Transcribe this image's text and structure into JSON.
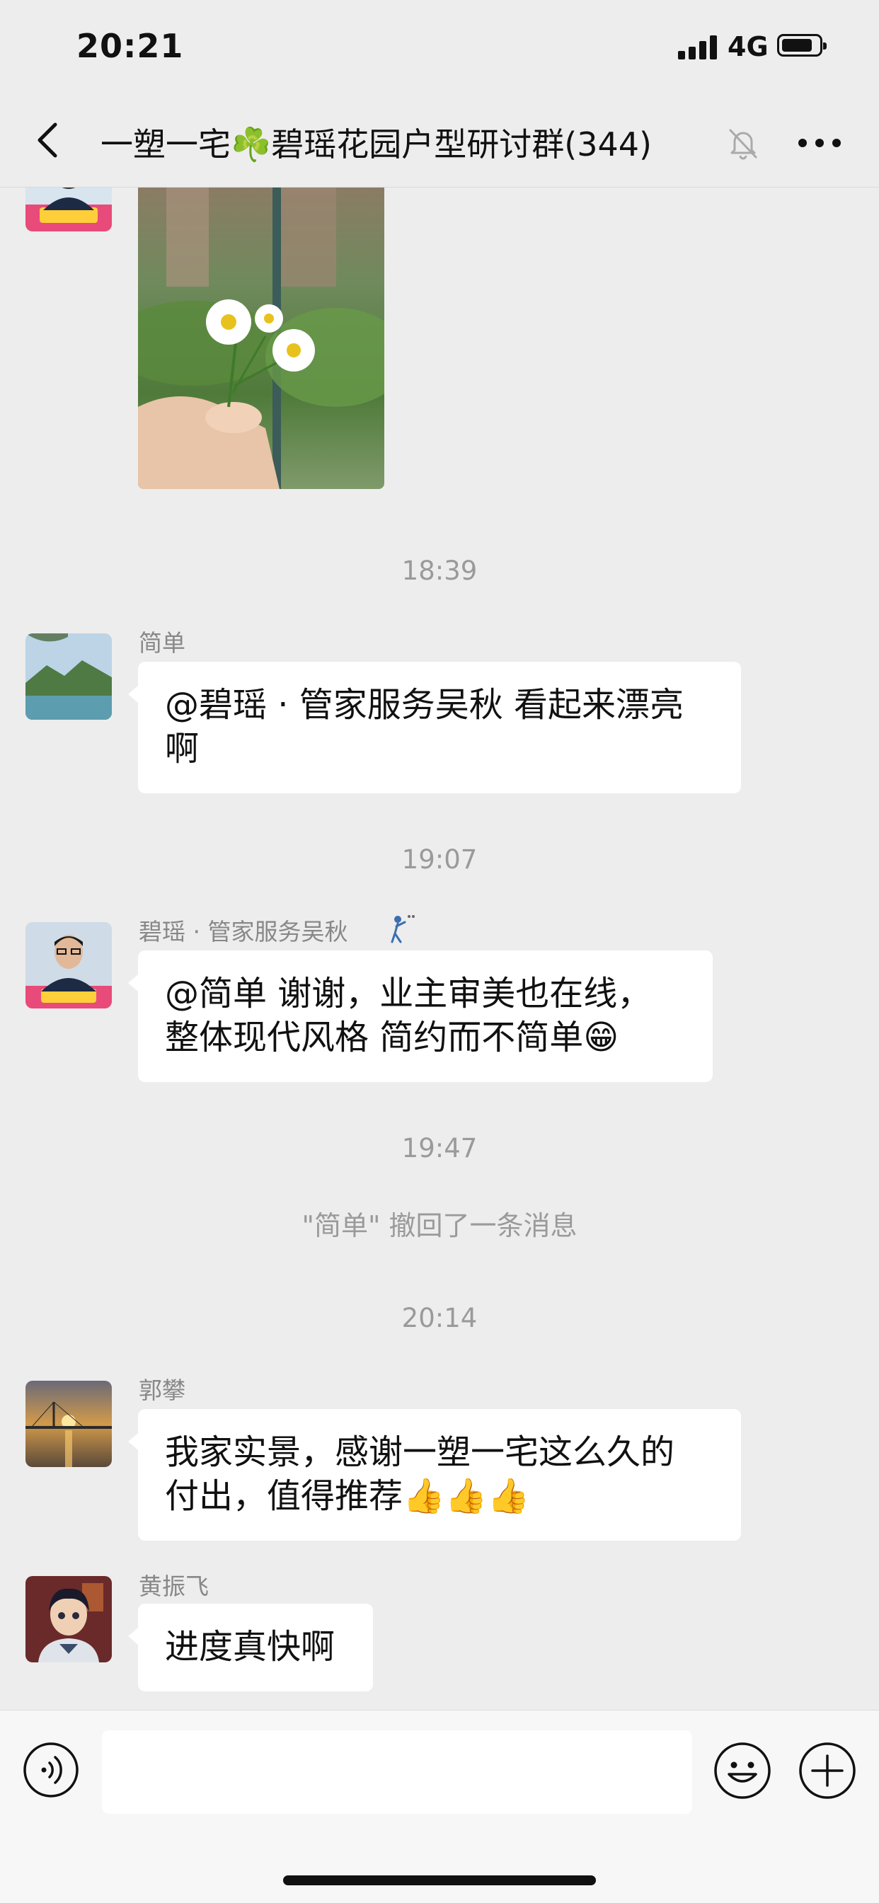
{
  "status_bar": {
    "time": "20:21",
    "network": "4G"
  },
  "header": {
    "title": "一塑一宅☘️碧瑶花园户型研讨群(344)",
    "back_icon": "chevron-left-icon",
    "mute_icon": "bell-slash-icon",
    "more_icon": "more-dots-icon"
  },
  "messages": [
    {
      "type": "image",
      "sender_avatar": "avatar-wu-qiu",
      "image": "photo-daisy-flowers-in-hand"
    },
    {
      "type": "timestamp",
      "text": "18:39"
    },
    {
      "type": "text",
      "sender": "简单",
      "text_line1": "@碧瑶 · 管家服务吴秋 看起来漂亮",
      "text_line2": "啊"
    },
    {
      "type": "timestamp",
      "text": "19:07"
    },
    {
      "type": "text",
      "sender": "碧瑶 · 管家服务吴秋",
      "sender_badge": "person-status-icon",
      "text_line1": "@简单   谢谢，业主审美也在线，",
      "text_line2": "整体现代风格  简约而不简单😁"
    },
    {
      "type": "timestamp",
      "text": "19:47"
    },
    {
      "type": "system",
      "text": "\"简单\" 撤回了一条消息"
    },
    {
      "type": "timestamp",
      "text": "20:14"
    },
    {
      "type": "text",
      "sender": "郭攀",
      "text_line1": "我家实景，感谢一塑一宅这么久的",
      "text_line2": "付出，值得推荐👍👍👍"
    },
    {
      "type": "text",
      "sender": "黄振飞",
      "text_line1": "进度真快啊"
    }
  ],
  "input_bar": {
    "voice_icon": "voice-icon",
    "input_value": "",
    "emoji_icon": "emoji-icon",
    "plus_icon": "plus-icon"
  },
  "colors": {
    "background": "#ededed",
    "bubble": "#ffffff",
    "meta_text": "#9a9a9a"
  }
}
